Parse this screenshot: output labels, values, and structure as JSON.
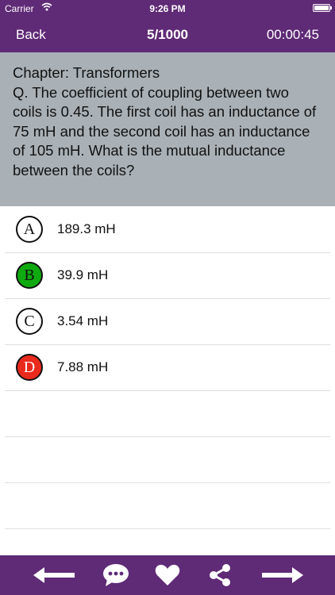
{
  "status_bar": {
    "carrier": "Carrier",
    "time": "9:26 PM"
  },
  "nav": {
    "back_label": "Back",
    "counter": "5/1000",
    "timer": "00:00:45"
  },
  "question": {
    "chapter": "Chapter: Transformers",
    "text": "Q. The coefficient of coupling between two coils is 0.45. The first coil has an inductance of 75 mH and the second coil has an inductance of 105 mH. What is the mutual inductance between the coils?"
  },
  "answers": [
    {
      "letter": "A",
      "text": "189.3 mH",
      "state": "default"
    },
    {
      "letter": "B",
      "text": "39.9 mH",
      "state": "correct"
    },
    {
      "letter": "C",
      "text": "3.54 mH",
      "state": "default"
    },
    {
      "letter": "D",
      "text": "7.88 mH",
      "state": "wrong"
    }
  ],
  "colors": {
    "brand": "#5f2a76",
    "question_bg": "#a9b1b7",
    "correct": "#0faa0f",
    "wrong": "#ea2a1c"
  },
  "toolbar_icons": [
    "arrow-left-icon",
    "comment-icon",
    "heart-icon",
    "share-icon",
    "arrow-right-icon"
  ]
}
